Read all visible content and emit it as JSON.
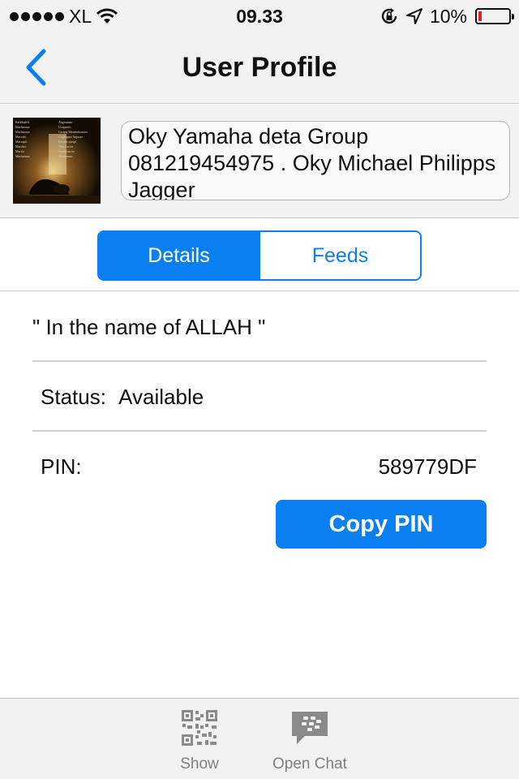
{
  "status_bar": {
    "carrier": "XL",
    "time": "09.33",
    "battery_percent": "10%",
    "battery_level": 0.1,
    "icons": [
      "signal-dots",
      "wifi-icon",
      "rotation-lock-icon",
      "location-arrow-icon",
      "battery-icon"
    ]
  },
  "nav": {
    "title": "User Profile",
    "back_icon": "chevron-left-icon"
  },
  "profile": {
    "name_line1": "Oky Yamaha deta Group",
    "name_line2": "081219454975 . Oky Michael Philipps",
    "name_line3": "Jagger"
  },
  "segments": {
    "details": "Details",
    "feeds": "Feeds",
    "selected": "Details"
  },
  "details": {
    "personal_message": "\" In the name of ALLAH \"",
    "status_label": "Status:",
    "status_value": "Available",
    "pin_label": "PIN:",
    "pin_value": "589779DF",
    "copy_button": "Copy PIN"
  },
  "tab_bar": {
    "show_label": "Show",
    "open_chat_label": "Open Chat"
  },
  "colors": {
    "accent": "#0a7ff0",
    "bar_background": "#f2f2f2",
    "battery_low": "#e02020"
  }
}
